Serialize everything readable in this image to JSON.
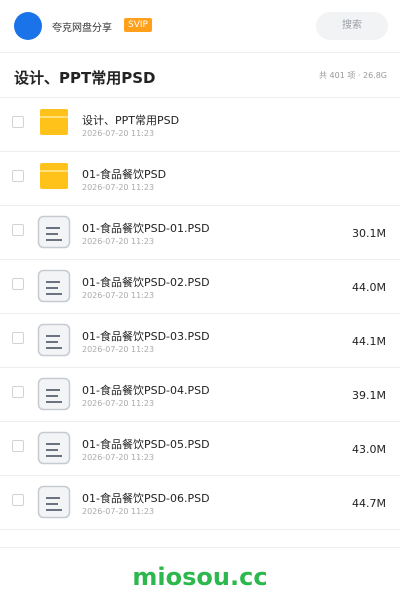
{
  "header": {
    "share_name": "夸克网盘分享",
    "badge": "SVIP",
    "search_label": "搜索"
  },
  "folder_title": "设计、PPT常用PSD",
  "summary": "共 401 项 · 26.8G",
  "items": [
    {
      "type": "folder",
      "name": "设计、PPT常用PSD",
      "date": "2026-07-20 11:23",
      "size": ""
    },
    {
      "type": "folder",
      "name": "01-食品餐饮PSD",
      "date": "2026-07-20 11:23",
      "size": ""
    },
    {
      "type": "file",
      "name": "01-食品餐饮PSD-01.PSD",
      "date": "2026-07-20 11:23",
      "size": "30.1M"
    },
    {
      "type": "file",
      "name": "01-食品餐饮PSD-02.PSD",
      "date": "2026-07-20 11:23",
      "size": "44.0M"
    },
    {
      "type": "file",
      "name": "01-食品餐饮PSD-03.PSD",
      "date": "2026-07-20 11:23",
      "size": "44.1M"
    },
    {
      "type": "file",
      "name": "01-食品餐饮PSD-04.PSD",
      "date": "2026-07-20 11:23",
      "size": "39.1M"
    },
    {
      "type": "file",
      "name": "01-食品餐饮PSD-05.PSD",
      "date": "2026-07-20 11:23",
      "size": "43.0M"
    },
    {
      "type": "file",
      "name": "01-食品餐饮PSD-06.PSD",
      "date": "2026-07-20 11:23",
      "size": "44.7M"
    }
  ],
  "watermark": "miosou.cc",
  "colors": {
    "avatar": "#1a73e8",
    "svip_badge": "#ff9f1a",
    "folder": "#ffc21a",
    "watermark": "#2db84d"
  }
}
